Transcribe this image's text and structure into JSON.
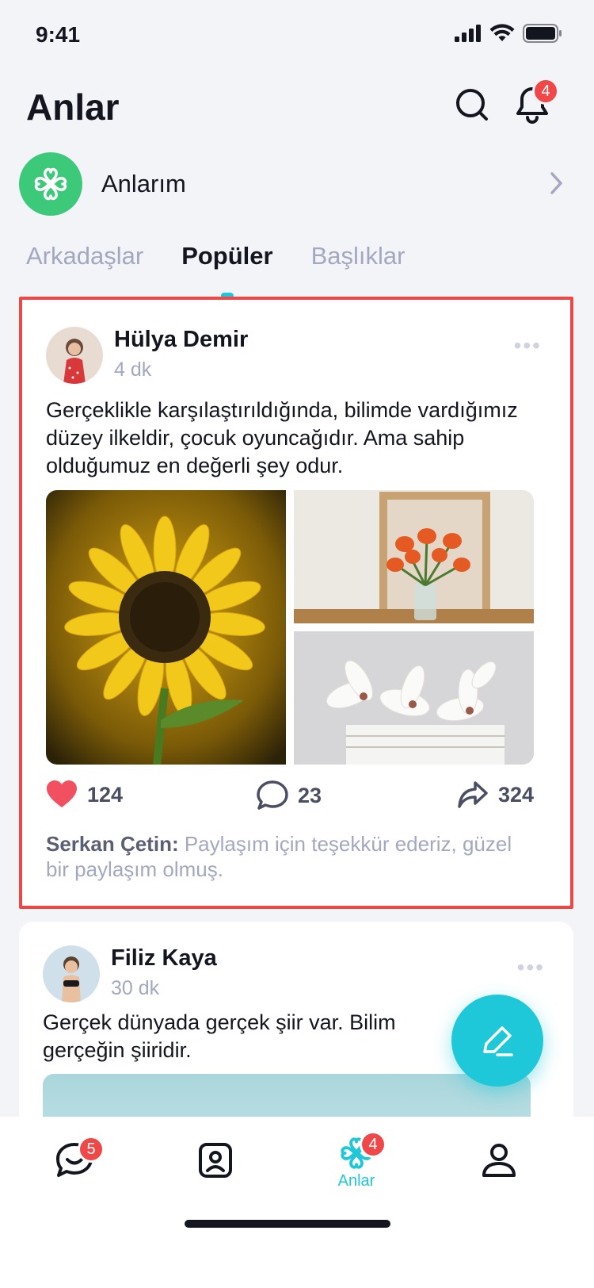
{
  "status_bar": {
    "time": "9:41"
  },
  "header": {
    "title": "Anlar",
    "notification_count": "4"
  },
  "my_moments": {
    "label": "Anlarım"
  },
  "tabs": [
    {
      "label": "Arkadaşlar",
      "active": false
    },
    {
      "label": "Popüler",
      "active": true
    },
    {
      "label": "Başlıklar",
      "active": false
    }
  ],
  "posts": [
    {
      "author": "Hülya Demir",
      "time": "4 dk",
      "text": "Gerçeklikle karşılaştırıldığında, bilimde vardığımız düzey ilkeldir, çocuk oyuncağıdır. Ama sahip olduğumuz en değerli şey odur.",
      "likes": "124",
      "comments": "23",
      "shares": "324",
      "comment_preview": {
        "author": "Serkan Çetin:",
        "text": "Paylaşım için teşekkür ederiz, güzel bir paylaşım olmuş."
      }
    },
    {
      "author": "Filiz Kaya",
      "time": "30 dk",
      "text": "Gerçek dünyada gerçek şiir var. Bilim gerçeğin şiiridir."
    }
  ],
  "bottom_nav": {
    "chats_badge": "5",
    "moments_badge": "4",
    "moments_label": "Anlar"
  },
  "colors": {
    "accent": "#1ec8d8",
    "badge": "#f04848",
    "like": "#f05060",
    "my_moments_bg": "#3dc97a",
    "highlight_border": "#ec4848"
  }
}
